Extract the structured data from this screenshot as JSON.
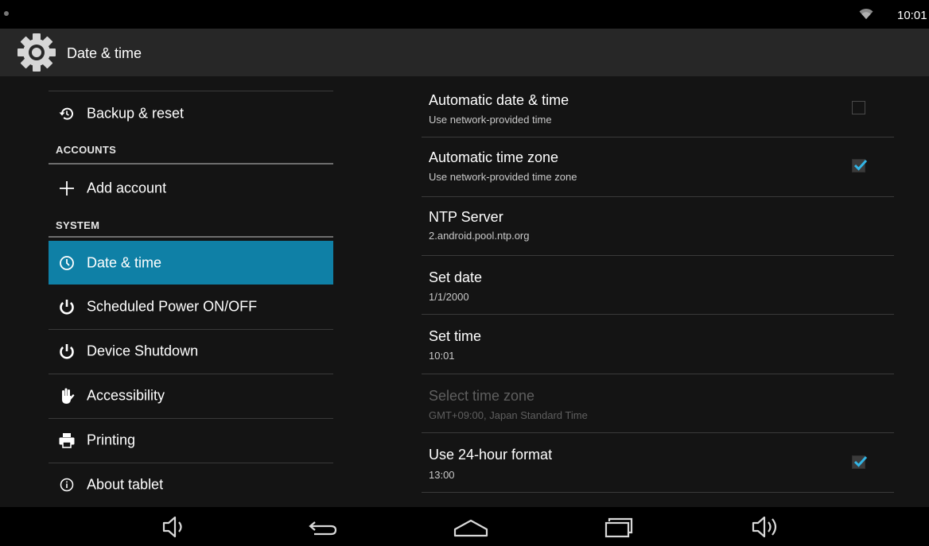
{
  "status_bar": {
    "time": "10:01",
    "wifi_icon": "wifi-icon"
  },
  "action_bar": {
    "title": "Date & time",
    "icon": "settings-gear-icon"
  },
  "left_pane": {
    "items": [
      {
        "label": "Backup & reset",
        "icon": "restore-icon"
      },
      {
        "header": "ACCOUNTS"
      },
      {
        "label": "Add account",
        "icon": "plus-icon"
      },
      {
        "header": "SYSTEM"
      },
      {
        "label": "Date & time",
        "icon": "clock-icon",
        "selected": true
      },
      {
        "label": "Scheduled Power ON/OFF",
        "icon": "power-icon"
      },
      {
        "label": "Device Shutdown",
        "icon": "power-icon"
      },
      {
        "label": "Accessibility",
        "icon": "hand-icon"
      },
      {
        "label": "Printing",
        "icon": "printer-icon"
      },
      {
        "label": "About tablet",
        "icon": "info-icon"
      }
    ]
  },
  "right_pane": {
    "items": [
      {
        "title": "Automatic date & time",
        "subtitle": "Use network-provided time",
        "checkbox": false
      },
      {
        "title": "Automatic time zone",
        "subtitle": "Use network-provided time zone",
        "checkbox": true
      },
      {
        "title": "NTP Server",
        "subtitle": "2.android.pool.ntp.org"
      },
      {
        "title": "Set date",
        "subtitle": "1/1/2000"
      },
      {
        "title": "Set time",
        "subtitle": "10:01"
      },
      {
        "title": "Select time zone",
        "subtitle": "GMT+09:00, Japan Standard Time",
        "disabled": true
      },
      {
        "title": "Use 24-hour format",
        "subtitle": "13:00",
        "checkbox": true
      }
    ]
  },
  "nav_bar": {
    "buttons": [
      "volume-down-icon",
      "back-icon",
      "home-icon",
      "recents-icon",
      "volume-up-icon"
    ]
  },
  "colors": {
    "accent": "#0f80a6",
    "check": "#33b5e5",
    "background": "#141414"
  }
}
